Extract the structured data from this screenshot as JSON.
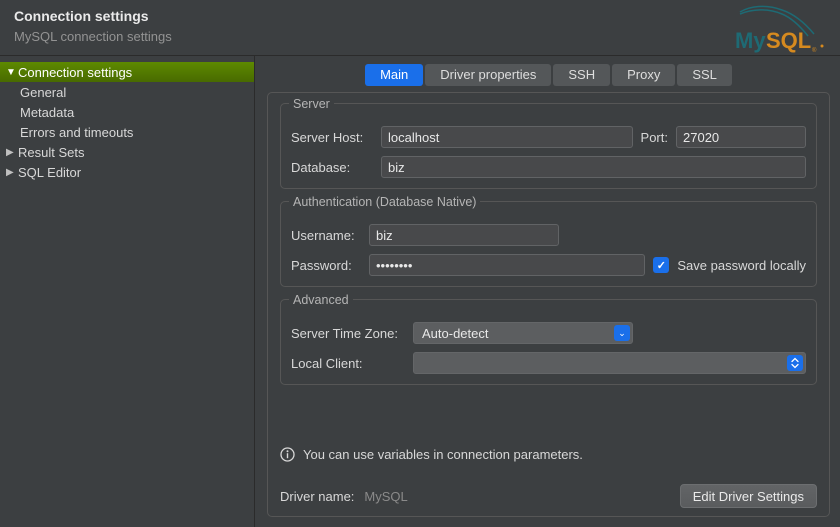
{
  "header": {
    "title": "Connection settings",
    "subtitle": "MySQL connection settings",
    "logo_text": "MySQL"
  },
  "sidebar": {
    "items": [
      {
        "label": "Connection settings",
        "expandable": true,
        "selected": true
      },
      {
        "label": "General",
        "child": true
      },
      {
        "label": "Metadata",
        "child": true
      },
      {
        "label": "Errors and timeouts",
        "child": true
      },
      {
        "label": "Result Sets",
        "expandable": true
      },
      {
        "label": "SQL Editor",
        "expandable": true
      }
    ]
  },
  "tabs": [
    {
      "label": "Main",
      "active": true
    },
    {
      "label": "Driver properties"
    },
    {
      "label": "SSH"
    },
    {
      "label": "Proxy"
    },
    {
      "label": "SSL"
    }
  ],
  "groups": {
    "server": {
      "title": "Server",
      "host_label": "Server Host:",
      "host_value": "localhost",
      "port_label": "Port:",
      "port_value": "27020",
      "db_label": "Database:",
      "db_value": "biz"
    },
    "auth": {
      "title": "Authentication (Database Native)",
      "user_label": "Username:",
      "user_value": "biz",
      "pass_label": "Password:",
      "pass_value": "••••••••",
      "save_pw_label": "Save password locally",
      "save_pw_checked": true
    },
    "advanced": {
      "title": "Advanced",
      "tz_label": "Server Time Zone:",
      "tz_value": "Auto-detect",
      "localclient_label": "Local Client:",
      "localclient_value": ""
    }
  },
  "footer": {
    "info_text": "You can use variables in connection parameters.",
    "driver_label": "Driver name:",
    "driver_value": "MySQL",
    "edit_driver_btn": "Edit Driver Settings"
  }
}
